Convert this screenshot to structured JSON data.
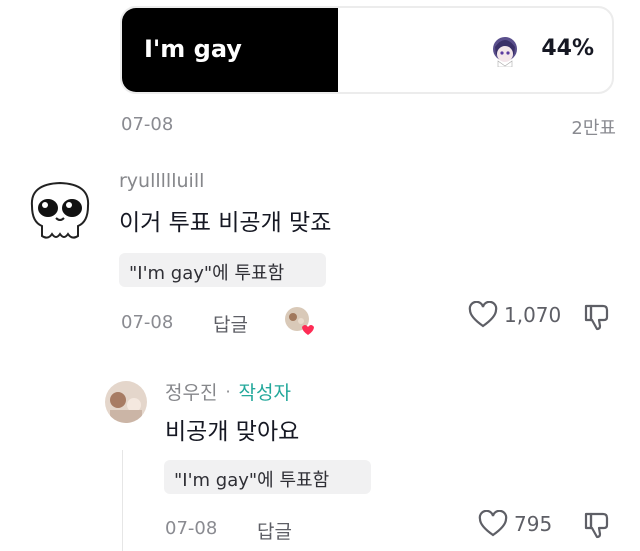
{
  "poll": {
    "option_label": "I'm gay",
    "percent_text": "44%",
    "percent_value": 44,
    "date": "07-08",
    "vote_count": "2만표",
    "avatar_icon": "anime-character-avatar-icon"
  },
  "comments": [
    {
      "username": "ryullllluill",
      "text": "이거 투표 비공개 맞죠",
      "vote_chip": "\"I'm gay\"에 투표함",
      "date": "07-08",
      "reply_label": "답글",
      "like_count": "1,070",
      "avatar_icon": "cartoon-skull-avatar-icon"
    },
    {
      "username": "정우진",
      "separator": "·",
      "author_badge": "작성자",
      "text": "비공개 맞아요",
      "vote_chip": "\"I'm gay\"에 투표함",
      "date": "07-08",
      "reply_label": "답글",
      "like_count": "795"
    }
  ],
  "colors": {
    "poll_fill": "#000000",
    "author_badge": "#23a89b",
    "heart_badge": "#fe2c55"
  }
}
